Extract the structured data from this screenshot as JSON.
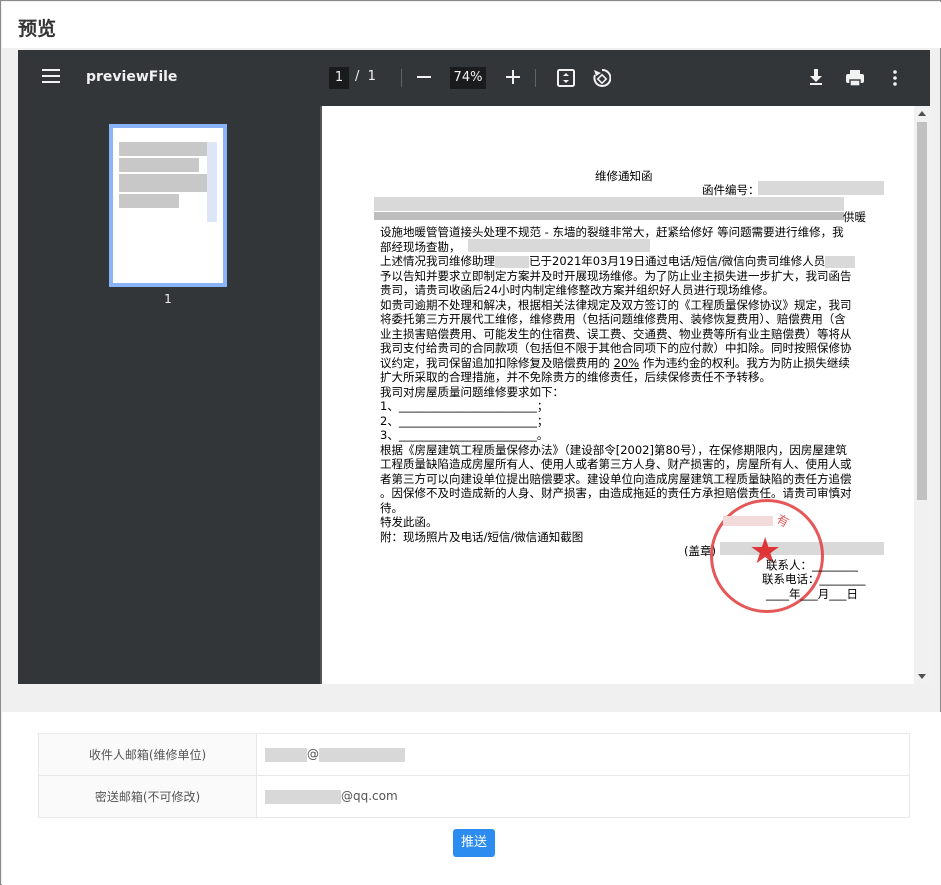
{
  "page": {
    "title": "预览"
  },
  "viewer": {
    "filename": "previewFile",
    "current_page": "1",
    "page_separator": "/",
    "total_pages": "1",
    "zoom": "74%",
    "thumbnail_number": "1"
  },
  "document": {
    "title": "维修通知函",
    "letter_no_label": "函件编号：",
    "para1_tail": "供暖",
    "line2": "设施地暖管管道接头处理不规范 - 东墙的裂缝非常大，赶紧给修好 等问题需要进行维修，我",
    "line3": "部经现场查勘，",
    "line4_a": "上述情况我司维修助理",
    "line4_b": "已于2021年03月19日通过电话/短信/微信向贵司维修人员",
    "line5": "予以告知并要求立即制定方案并及时开展现场维修。为了防止业主损失进一步扩大，我司函告",
    "line6": "贵司，请贵司收函后24小时内制定维修整改方案并组织好人员进行现场维修。",
    "line7": "如贵司逾期不处理和解决，根据相关法律规定及双方签订的《工程质量保修协议》规定，我司",
    "line8": "将委托第三方开展代工维修，维修费用（包括问题维修费用、装修恢复费用）、赔偿费用（含",
    "line9": "业主损害赔偿费用、可能发生的住宿费、误工费、交通费、物业费等所有业主赔偿费）等将从",
    "line10": "我司支付给贵司的合同款项（包括但不限于其他合同项下的应付款）中扣除。同时按照保修协",
    "line11_a": "议约定，我司保留追加扣除修复及赔偿费用的",
    "line11_pct": "20%",
    "line11_b": "作为违约金的权利。我方为防止损失继续",
    "line12": "扩大所采取的合理措施，并不免除贵方的维修责任，后续保修责任不予转移。",
    "line13": "我司对房屋质量问题维修要求如下：",
    "item1": "1、________________________；",
    "item2": "2、________________________；",
    "item3": "3、________________________。",
    "line17": "根据《房屋建筑工程质量保修办法》（建设部令[2002]第80号），在保修期限内，因房屋建筑",
    "line18": "工程质量缺陷造成房屋所有人、使用人或者第三方人身、财产损害的，房屋所有人、使用人或",
    "line19": "者第三方可以向建设单位提出赔偿要求。建设单位向造成房屋建筑工程质量缺陷的责任方追偿",
    "line20": "。因保修不及时造成新的人身、财产损害，由造成拖延的责任方承担赔偿责任。请贵司审慎对",
    "line21": "待。",
    "line22": "特发此函。",
    "line23": "附：现场照片及电话/短信/微信通知截图",
    "stamp_label": "(盖章)",
    "contact_label": "联系人：",
    "phone_label": "联系电话：",
    "date_line": "____年___月___日",
    "stamp_char": "有"
  },
  "form": {
    "recipient_label": "收件人邮箱(维修单位)",
    "recipient_at": "@",
    "cc_label": "密送邮箱(不可修改)",
    "cc_domain": "@qq.com",
    "send_label": "推送"
  },
  "colors": {
    "toolbar": "#323639",
    "viewer_bg": "#525659",
    "thumb_border": "#8ab4f8",
    "stamp": "#e23b3b",
    "send_button": "#2d8cf0"
  }
}
